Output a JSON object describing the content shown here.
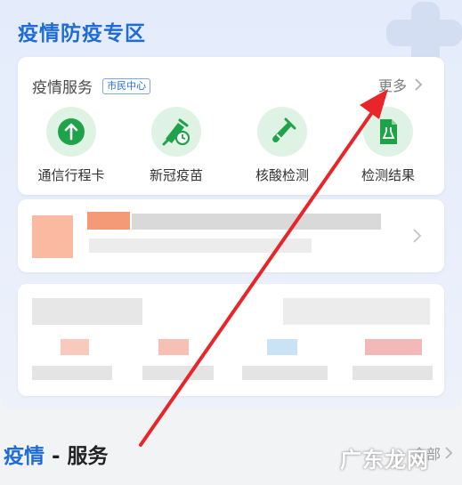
{
  "zone": {
    "title": "疫情防疫专区"
  },
  "services": {
    "title": "疫情服务",
    "tag": "市民中心",
    "more_label": "更多",
    "items": [
      {
        "label": "通信行程卡",
        "icon": "upload-arrow-icon"
      },
      {
        "label": "新冠疫苗",
        "icon": "vaccine-clock-icon"
      },
      {
        "label": "核酸检测",
        "icon": "test-tube-icon"
      },
      {
        "label": "检测结果",
        "icon": "report-flask-icon"
      }
    ]
  },
  "bottom": {
    "title_accent": "疫情",
    "title_rest": " - 服务",
    "all_label": "全部"
  },
  "watermark": "广东龙网",
  "colors": {
    "accent_blue": "#1f6cd8",
    "icon_green": "#1fa34a",
    "icon_bg": "#dff3e4",
    "arrow_red": "#e8262a"
  }
}
